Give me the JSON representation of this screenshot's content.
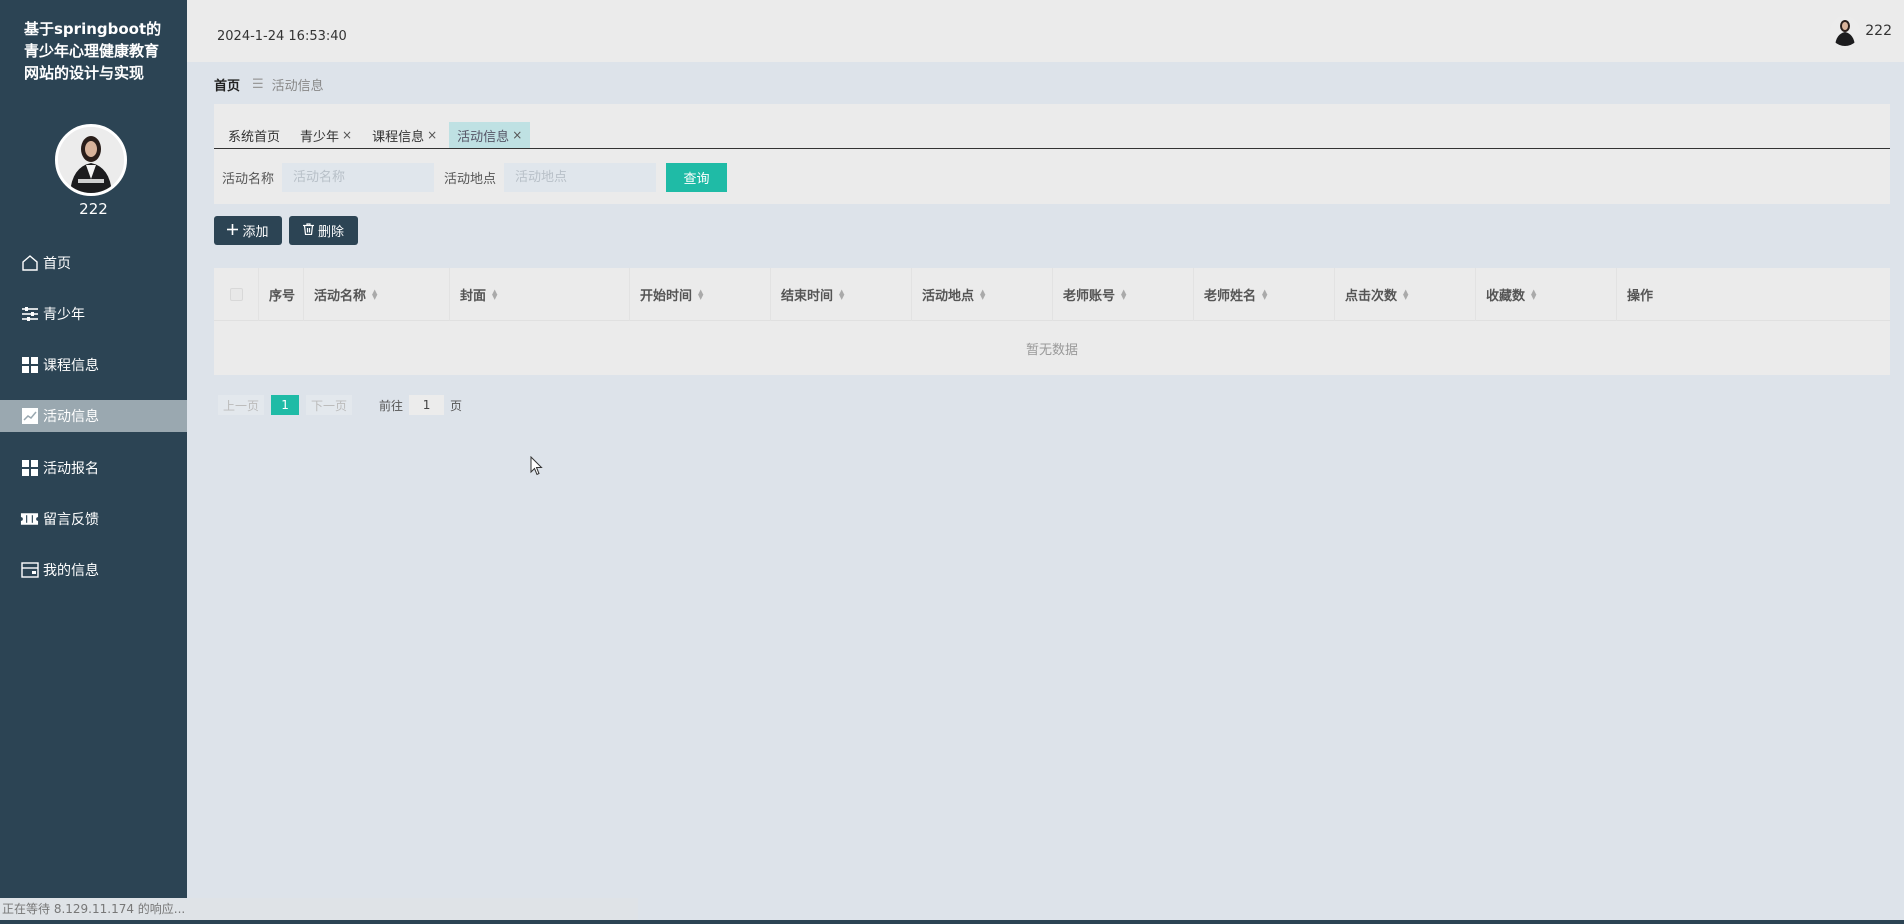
{
  "app": {
    "title": "基于springboot的青少年心理健康教育网站的设计与实现",
    "username": "222",
    "datetime": "2024-1-24 16:53:40"
  },
  "sidebar": {
    "items": [
      {
        "label": "首页",
        "icon": "home-icon"
      },
      {
        "label": "青少年",
        "icon": "sliders-icon"
      },
      {
        "label": "课程信息",
        "icon": "grid-icon"
      },
      {
        "label": "活动信息",
        "icon": "chart-icon",
        "active": true
      },
      {
        "label": "活动报名",
        "icon": "grid-icon"
      },
      {
        "label": "留言反馈",
        "icon": "ticket-icon"
      },
      {
        "label": "我的信息",
        "icon": "card-icon"
      }
    ]
  },
  "breadcrumb": {
    "home": "首页",
    "separator": "☰",
    "current": "活动信息"
  },
  "tabs": [
    {
      "label": "系统首页",
      "closable": false
    },
    {
      "label": "青少年",
      "closable": true
    },
    {
      "label": "课程信息",
      "closable": true
    },
    {
      "label": "活动信息",
      "closable": true,
      "active": true
    }
  ],
  "tab_close_glyph": "×",
  "search": {
    "name_label": "活动名称",
    "name_placeholder": "活动名称",
    "place_label": "活动地点",
    "place_placeholder": "活动地点",
    "query_button": "查询"
  },
  "actions": {
    "add_label": "添加",
    "delete_label": "删除"
  },
  "table": {
    "columns": [
      "序号",
      "活动名称",
      "封面",
      "开始时间",
      "结束时间",
      "活动地点",
      "老师账号",
      "老师姓名",
      "点击次数",
      "收藏数",
      "操作"
    ],
    "empty_text": "暂无数据"
  },
  "pagination": {
    "prev": "上一页",
    "current_page": "1",
    "next": "下一页",
    "goto_label": "前往",
    "goto_value": "1",
    "page_unit": "页"
  },
  "status_bar": {
    "text": "正在等待 8.129.11.174 的响应..."
  },
  "colors": {
    "sidebar_bg": "#2c4454",
    "accent": "#1fbba6",
    "active_tab": "#bfe1e3",
    "content_bg": "#dde3ea"
  }
}
